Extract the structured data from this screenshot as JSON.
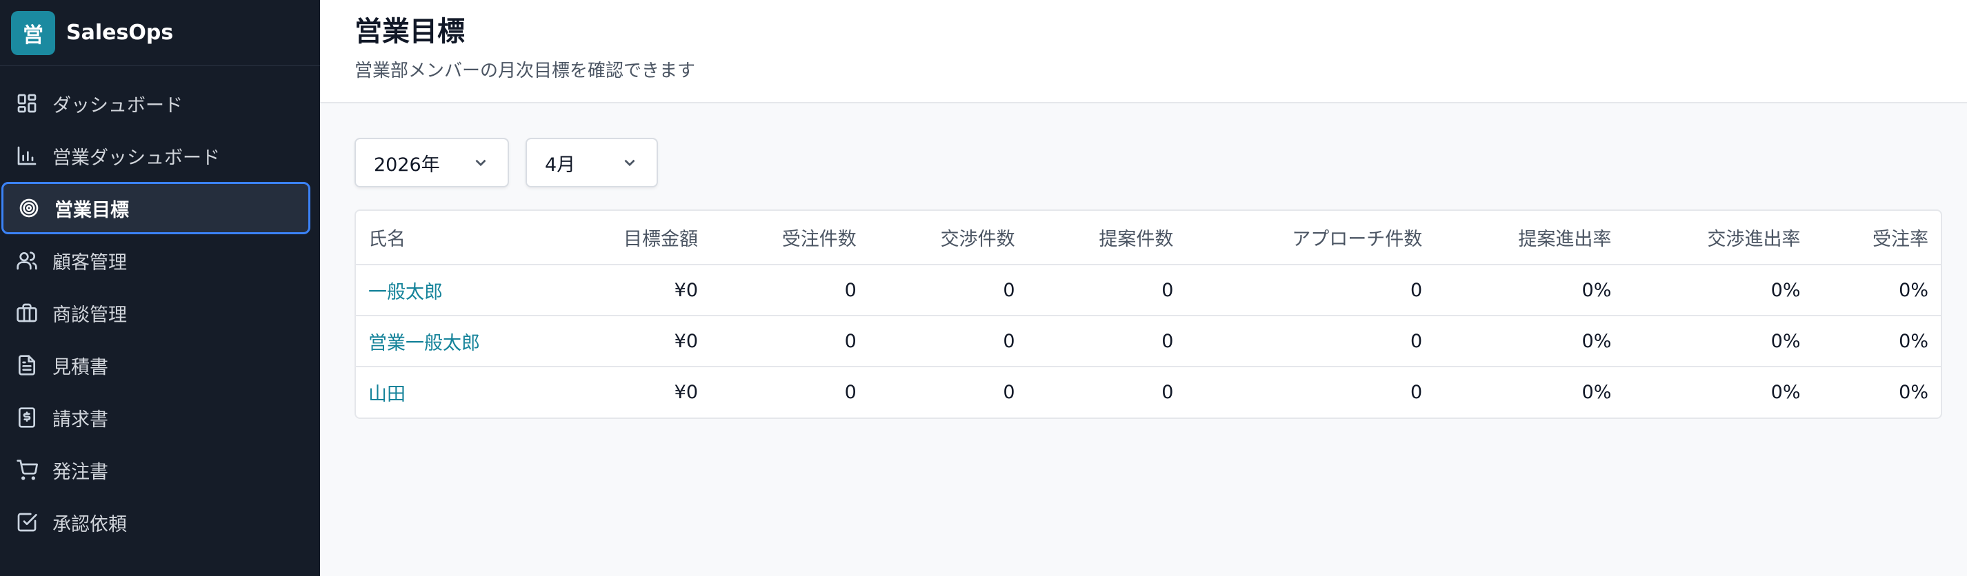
{
  "brand": {
    "logo_char": "営",
    "name": "SalesOps"
  },
  "sidebar": {
    "items": [
      {
        "label": "ダッシュボード",
        "icon": "dashboard-icon"
      },
      {
        "label": "営業ダッシュボード",
        "icon": "bar-chart-icon"
      },
      {
        "label": "営業目標",
        "icon": "target-icon",
        "active": true
      },
      {
        "label": "顧客管理",
        "icon": "users-icon"
      },
      {
        "label": "商談管理",
        "icon": "briefcase-icon"
      },
      {
        "label": "見積書",
        "icon": "document-icon"
      },
      {
        "label": "請求書",
        "icon": "invoice-icon"
      },
      {
        "label": "発注書",
        "icon": "cart-icon"
      },
      {
        "label": "承認依頼",
        "icon": "check-square-icon"
      }
    ]
  },
  "header": {
    "title": "営業目標",
    "subtitle": "営業部メンバーの月次目標を確認できます"
  },
  "filters": {
    "year": "2026年",
    "month": "4月"
  },
  "table": {
    "columns": [
      "氏名",
      "目標金額",
      "受注件数",
      "交渉件数",
      "提案件数",
      "アプローチ件数",
      "提案進出率",
      "交渉進出率",
      "受注率"
    ],
    "rows": [
      [
        "一般太郎",
        "¥0",
        "0",
        "0",
        "0",
        "0",
        "0%",
        "0%",
        "0%"
      ],
      [
        "営業一般太郎",
        "¥0",
        "0",
        "0",
        "0",
        "0",
        "0%",
        "0%",
        "0%"
      ],
      [
        "山田",
        "¥0",
        "0",
        "0",
        "0",
        "0",
        "0%",
        "0%",
        "0%"
      ]
    ]
  },
  "colors": {
    "sidebar_bg": "#151c28",
    "accent": "#1b8aa0",
    "active_border": "#3b82f6",
    "link": "#15839a"
  }
}
